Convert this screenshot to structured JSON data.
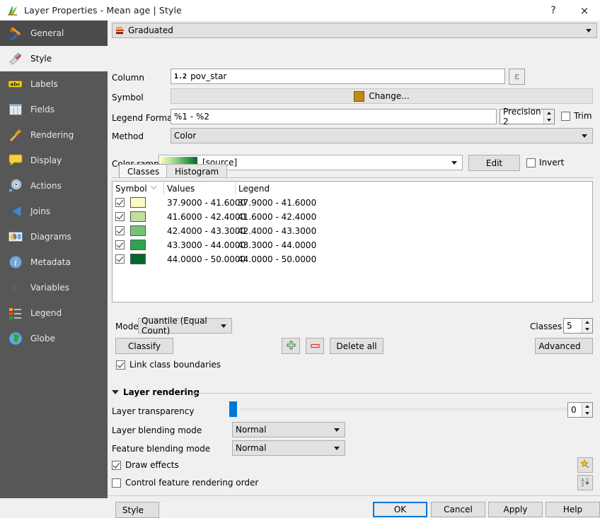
{
  "window": {
    "title": "Layer Properties - Mean age | Style",
    "icon": "qgis-layer-icon",
    "help_button": "?",
    "close_button": "×"
  },
  "sidebar": {
    "items": [
      {
        "label": "General",
        "icon": "tools-icon",
        "state": "normal"
      },
      {
        "label": "Style",
        "icon": "paintbrush-icon",
        "state": "active"
      },
      {
        "label": "Labels",
        "icon": "abc-label-icon",
        "state": "normal"
      },
      {
        "label": "Fields",
        "icon": "table-icon",
        "state": "normal"
      },
      {
        "label": "Rendering",
        "icon": "broom-icon",
        "state": "normal"
      },
      {
        "label": "Display",
        "icon": "speech-bubble-icon",
        "state": "normal"
      },
      {
        "label": "Actions",
        "icon": "gear-play-icon",
        "state": "normal"
      },
      {
        "label": "Joins",
        "icon": "join-arrow-icon",
        "state": "normal"
      },
      {
        "label": "Diagrams",
        "icon": "piechart-icon",
        "state": "normal"
      },
      {
        "label": "Metadata",
        "icon": "info-icon",
        "state": "normal"
      },
      {
        "label": "Variables",
        "icon": "epsilon-icon",
        "state": "normal"
      },
      {
        "label": "Legend",
        "icon": "legend-icon",
        "state": "normal"
      },
      {
        "label": "Globe",
        "icon": "globe-icon",
        "state": "normal"
      }
    ]
  },
  "style": {
    "renderer": {
      "value": "Graduated",
      "icon": "graduated-renderer-icon"
    },
    "column": {
      "label": "Column",
      "value": "pov_star",
      "type_prefix": "1.2",
      "expression_button": "ε"
    },
    "symbol": {
      "label": "Symbol",
      "change_label": "Change...",
      "color": "#c08a14"
    },
    "legend_format": {
      "label": "Legend Format",
      "value": "%1 - %2",
      "precision_label": "Precision 2",
      "trim_label": "Trim",
      "trim_checked": false
    },
    "method": {
      "label": "Method",
      "value": "Color"
    },
    "color_ramp": {
      "label": "Color ramp",
      "value": "[source]",
      "edit_label": "Edit",
      "invert_label": "Invert",
      "invert_checked": false,
      "gradient_start": "#f7fcb9",
      "gradient_end": "#00682a"
    }
  },
  "tabs": [
    {
      "label": "Classes",
      "selected": true
    },
    {
      "label": "Histogram",
      "selected": false
    }
  ],
  "classes_table": {
    "columns": [
      "Symbol",
      "Values",
      "Legend"
    ],
    "rows": [
      {
        "checked": true,
        "color": "#fbfbc8",
        "values": "37.9000 - 41.6000",
        "legend": "37.9000 - 41.6000"
      },
      {
        "checked": true,
        "color": "#bfdf9a",
        "values": "41.6000 - 42.4000",
        "legend": "41.6000 - 42.4000"
      },
      {
        "checked": true,
        "color": "#75c375",
        "values": "42.4000 - 43.3000",
        "legend": "42.4000 - 43.3000"
      },
      {
        "checked": true,
        "color": "#2da54e",
        "values": "43.3000 - 44.0000",
        "legend": "43.3000 - 44.0000"
      },
      {
        "checked": true,
        "color": "#00682a",
        "values": "44.0000 - 50.0000",
        "legend": "44.0000 - 50.0000"
      }
    ]
  },
  "classify_bar": {
    "mode_label": "Mode",
    "mode_value": "Quantile (Equal Count)",
    "classes_label": "Classes",
    "classes_count": "5",
    "classify_label": "Classify",
    "add_class_icon": "plus-icon",
    "remove_class_icon": "minus-icon",
    "delete_all_label": "Delete all",
    "advanced_label": "Advanced",
    "link_boundaries_label": "Link class boundaries",
    "link_boundaries_checked": true
  },
  "layer_rendering": {
    "title": "Layer rendering",
    "transparency_label": "Layer transparency",
    "transparency_value": "0",
    "layer_blending_label": "Layer blending mode",
    "layer_blending_value": "Normal",
    "feature_blending_label": "Feature blending mode",
    "feature_blending_value": "Normal",
    "draw_effects_label": "Draw effects",
    "draw_effects_checked": true,
    "effects_button_icon": "star-effects-icon",
    "control_order_label": "Control feature rendering order",
    "control_order_checked": false,
    "sort_button_icon": "az-sort-icon"
  },
  "footer": {
    "style_label": "Style",
    "ok_label": "OK",
    "cancel_label": "Cancel",
    "apply_label": "Apply",
    "help_label": "Help"
  }
}
